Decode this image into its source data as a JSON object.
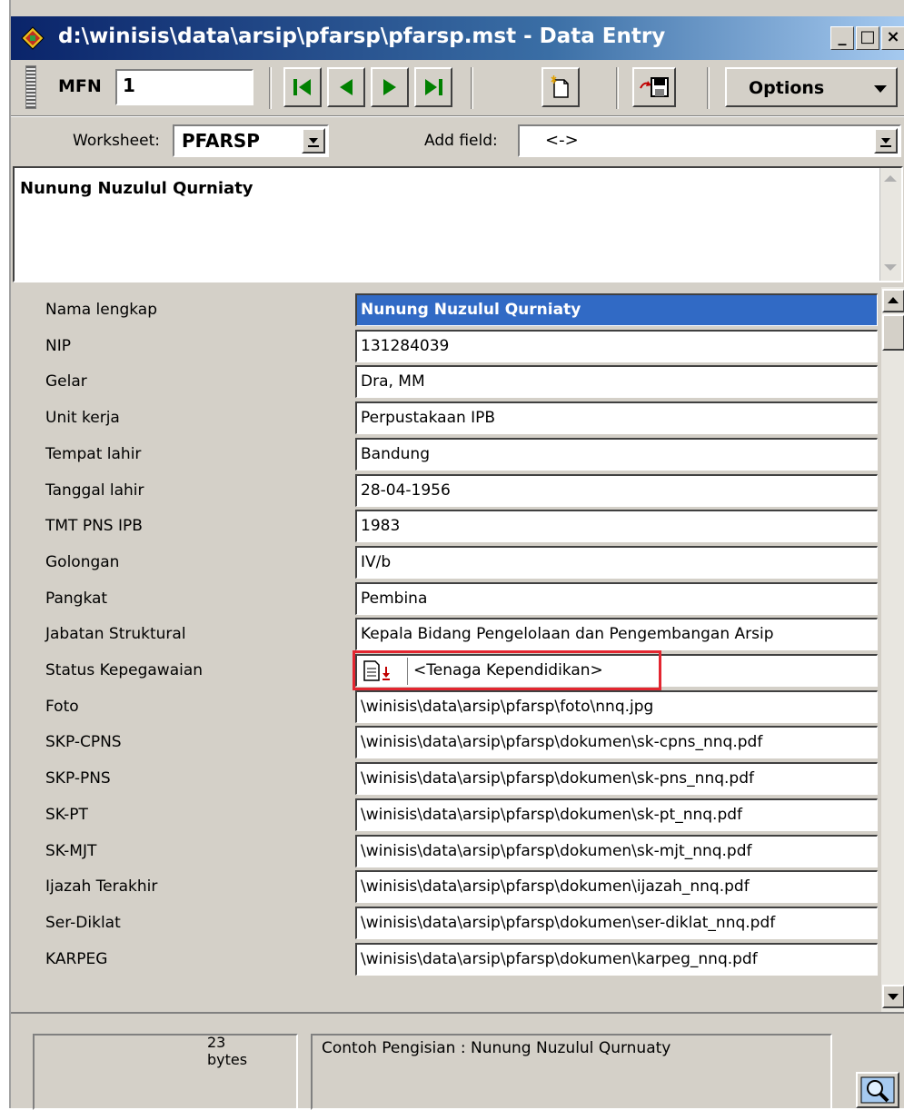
{
  "window": {
    "title": "d:\\winisis\\data\\arsip\\pfarsp\\pfarsp.mst - Data Entry",
    "minimize": "_",
    "maximize": "□",
    "close": "×"
  },
  "toolbar": {
    "mfn_label": "MFN",
    "mfn_value": "1",
    "options_label": "Options"
  },
  "worksheet": {
    "label": "Worksheet:",
    "value": "PFARSP",
    "add_field_label": "Add field:",
    "add_field_value": "<->"
  },
  "display": {
    "text": "Nunung Nuzulul Qurniaty"
  },
  "fields": [
    {
      "label": "Nama lengkap",
      "value": "Nunung Nuzulul Qurniaty"
    },
    {
      "label": "NIP",
      "value": "131284039"
    },
    {
      "label": "Gelar",
      "value": "Dra, MM"
    },
    {
      "label": "Unit kerja",
      "value": "Perpustakaan IPB"
    },
    {
      "label": "Tempat lahir",
      "value": "Bandung"
    },
    {
      "label": "Tanggal lahir",
      "value": "28-04-1956"
    },
    {
      "label": "TMT PNS IPB",
      "value": "1983"
    },
    {
      "label": "Golongan",
      "value": "IV/b"
    },
    {
      "label": "Pangkat",
      "value": "Pembina"
    },
    {
      "label": "Jabatan Struktural",
      "value": "Kepala Bidang Pengelolaan dan Pengembangan Arsip"
    },
    {
      "label": "Status Kepegawaian",
      "value": "<Tenaga Kependidikan>"
    },
    {
      "label": "Foto",
      "value": "\\winisis\\data\\arsip\\pfarsp\\foto\\nnq.jpg"
    },
    {
      "label": "SKP-CPNS",
      "value": "\\winisis\\data\\arsip\\pfarsp\\dokumen\\sk-cpns_nnq.pdf"
    },
    {
      "label": "SKP-PNS",
      "value": "\\winisis\\data\\arsip\\pfarsp\\dokumen\\sk-pns_nnq.pdf"
    },
    {
      "label": "SK-PT",
      "value": "\\winisis\\data\\arsip\\pfarsp\\dokumen\\sk-pt_nnq.pdf"
    },
    {
      "label": "SK-MJT",
      "value": "\\winisis\\data\\arsip\\pfarsp\\dokumen\\sk-mjt_nnq.pdf"
    },
    {
      "label": "Ijazah Terakhir",
      "value": "\\winisis\\data\\arsip\\pfarsp\\dokumen\\ijazah_nnq.pdf"
    },
    {
      "label": "Ser-Diklat",
      "value": "\\winisis\\data\\arsip\\pfarsp\\dokumen\\ser-diklat_nnq.pdf"
    },
    {
      "label": "KARPEG",
      "value": "\\winisis\\data\\arsip\\pfarsp\\dokumen\\karpeg_nnq.pdf"
    }
  ],
  "status": {
    "bytes_count": "23",
    "bytes_unit": "bytes",
    "hint": "Contoh Pengisian : Nunung Nuzulul Qurnuaty"
  },
  "colors": {
    "selected_field": "#316ac5",
    "highlight_box": "#e32630"
  }
}
